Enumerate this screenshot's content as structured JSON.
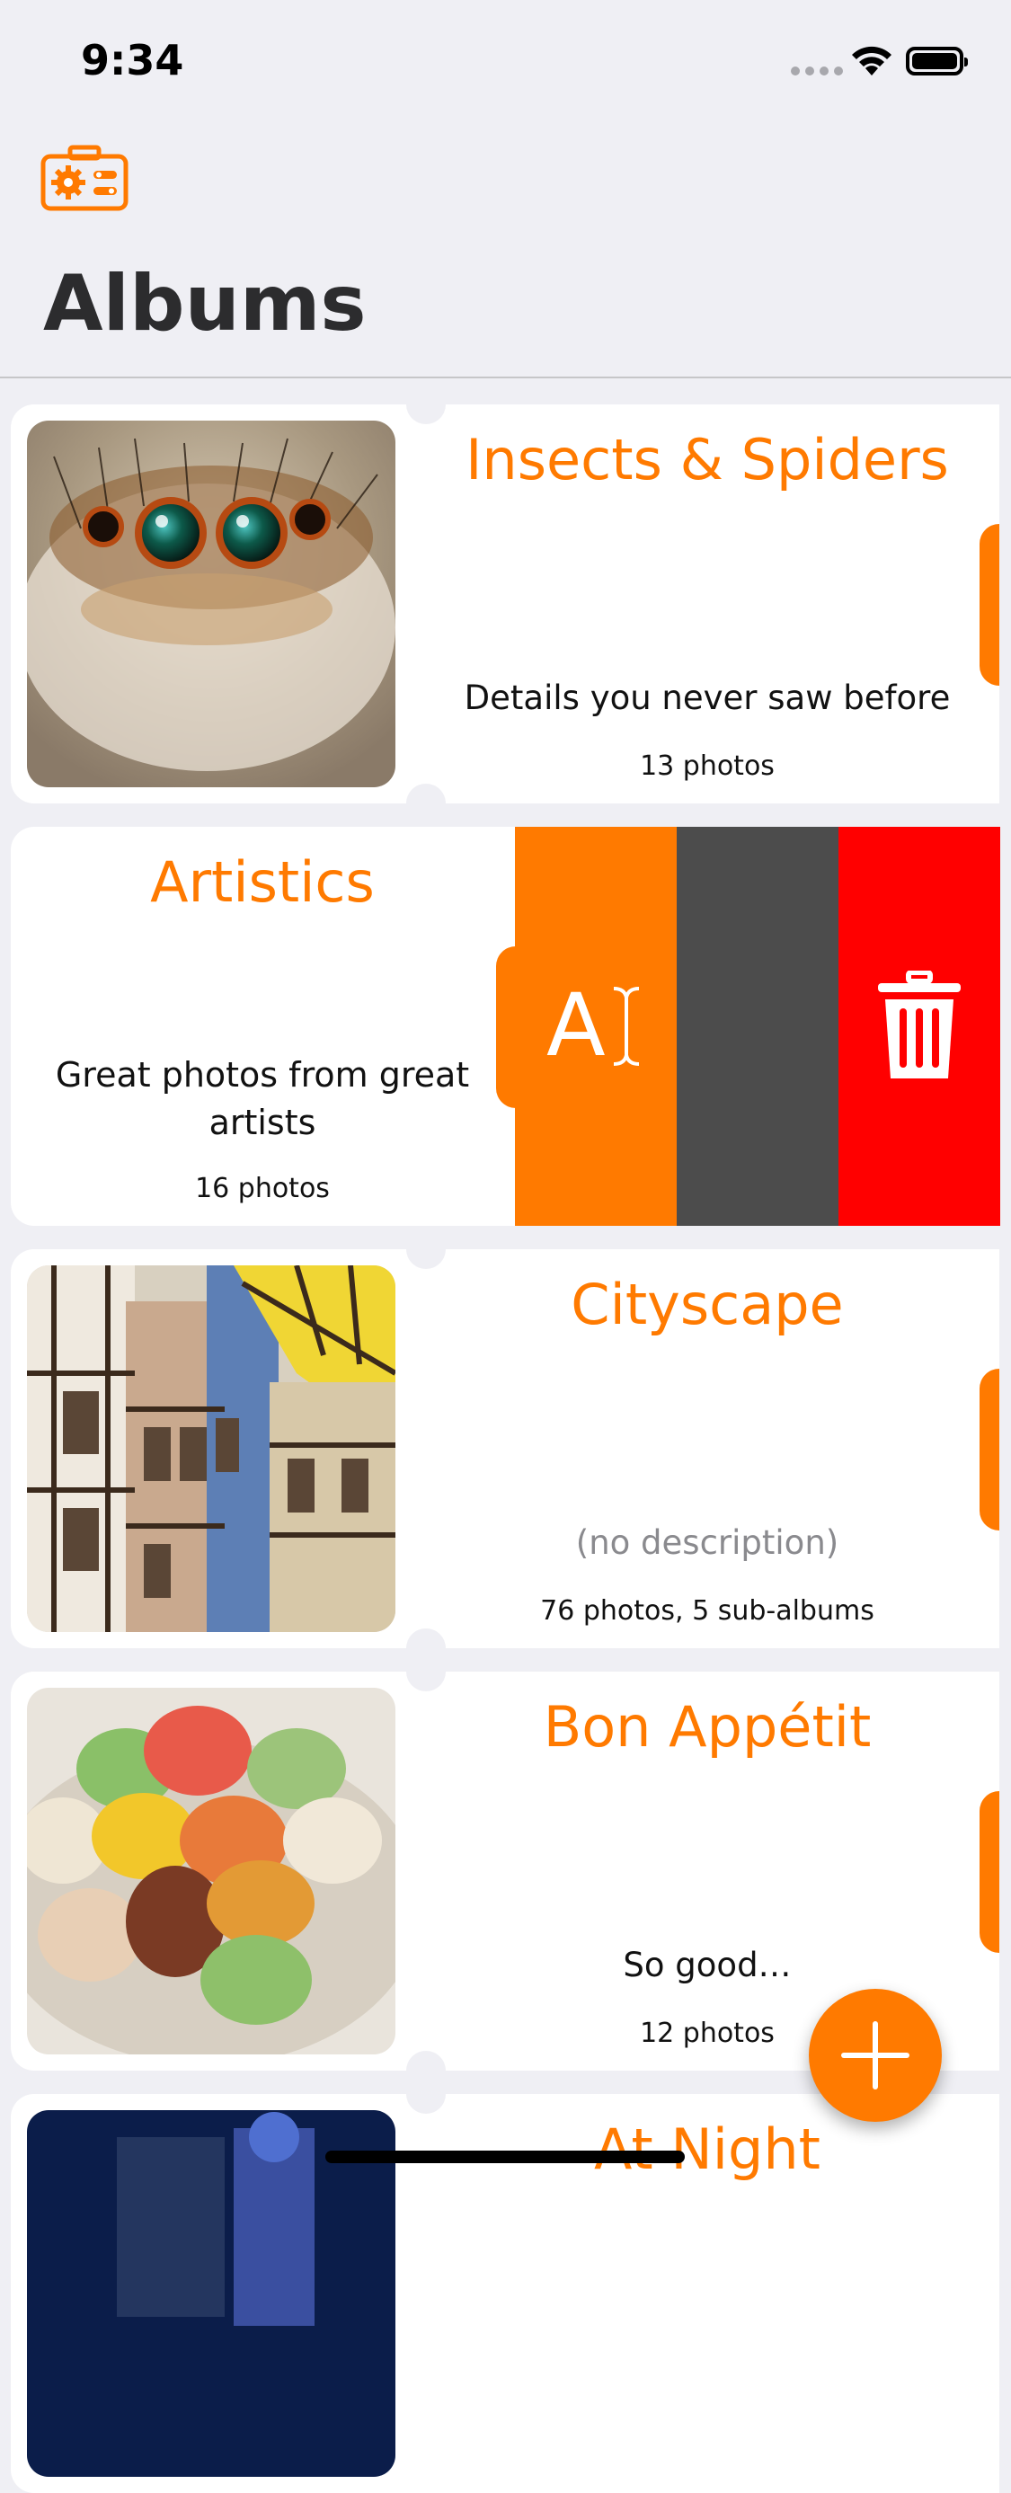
{
  "status_bar": {
    "time": "9:34"
  },
  "header": {
    "title": "Albums",
    "settings_icon": "camera-settings-icon"
  },
  "albums": [
    {
      "title": "Insects & Spiders",
      "description": "Details you never saw before",
      "count": "13 photos"
    },
    {
      "title": "Artistics",
      "description": "Great photos from great artists",
      "count": "16 photos"
    },
    {
      "title": "Cityscape",
      "description": "(no description)",
      "count": "76 photos, 5 sub-albums"
    },
    {
      "title": "Bon Appétit",
      "description": "So good…",
      "count": "12 photos"
    },
    {
      "title": "At Night"
    }
  ],
  "swipe_actions": {
    "rename_icon": "rename-icon",
    "more_icon": "",
    "delete_icon": "trash-icon"
  },
  "fab": {
    "icon": "plus-icon"
  },
  "colors": {
    "accent": "#ff7a00",
    "delete": "#ff0000",
    "more": "#4c4c4c",
    "background": "#efeff4"
  }
}
